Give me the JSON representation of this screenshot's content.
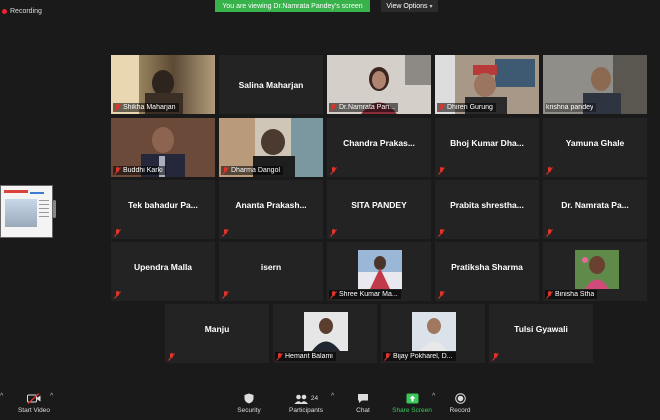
{
  "recording": {
    "label": "Recording"
  },
  "banner": {
    "text": "You are viewing Dr.Namrata Pandey's screen"
  },
  "view_options": {
    "label": "View Options"
  },
  "participants": [
    {
      "name": "Shikha Maharjan",
      "has_video": true,
      "tile_label": "Shikha Maharjan"
    },
    {
      "name": "Salina Maharjan",
      "has_video": false
    },
    {
      "name": "Dr.Namrata Pan...",
      "has_video": true,
      "tile_label": "Dr.Namrata Pan..."
    },
    {
      "name": "Dhiren Gurung",
      "has_video": true,
      "tile_label": "Dhiren Gurung"
    },
    {
      "name": "krishna pandey",
      "has_video": true,
      "tile_label": "krishna pandey",
      "active_speaker": true
    },
    {
      "name": "Buddhi Karki",
      "has_video": true,
      "tile_label": "Buddhi Karki"
    },
    {
      "name": "Dharma Dangol",
      "has_video": true,
      "tile_label": "Dharma Dangol"
    },
    {
      "name": "Chandra Prakas...",
      "has_video": false
    },
    {
      "name": "Bhoj Kumar Dha...",
      "has_video": false
    },
    {
      "name": "Yamuna Ghale",
      "has_video": false
    },
    {
      "name": "Tek bahadur Pa...",
      "has_video": false
    },
    {
      "name": "Ananta Prakash...",
      "has_video": false
    },
    {
      "name": "SITA PANDEY",
      "has_video": false
    },
    {
      "name": "Prabita shrestha...",
      "has_video": false
    },
    {
      "name": "Dr. Namrata Pa...",
      "has_video": false
    },
    {
      "name": "Upendra Malla",
      "has_video": false
    },
    {
      "name": "isern",
      "has_video": false
    },
    {
      "name": "Shree Kumar Ma...",
      "has_video": false,
      "profile_photo": true,
      "tile_label": "Shree Kumar Ma..."
    },
    {
      "name": "Pratiksha Sharma",
      "has_video": false
    },
    {
      "name": "Binisha Stha",
      "has_video": false,
      "profile_photo": true,
      "tile_label": "Binisha Stha"
    },
    {
      "name": "Manju",
      "has_video": false
    },
    {
      "name": "Hemant Balami",
      "has_video": false,
      "profile_photo": true,
      "tile_label": "Hemant Balami"
    },
    {
      "name": "Bijay Pokharel, D...",
      "has_video": false,
      "profile_photo": true,
      "tile_label": "Bijay Pokharel, D..."
    },
    {
      "name": "Tulsi Gyawali",
      "has_video": false
    }
  ],
  "toolbar": {
    "start_video": "Start Video",
    "security": "Security",
    "participants": "Participants",
    "participants_count": "24",
    "chat": "Chat",
    "share_screen": "Share Screen",
    "record": "Record"
  },
  "colors": {
    "banner_green": "#38b24a",
    "active_outline": "#f5d90a",
    "muted_red": "#e0342a"
  }
}
